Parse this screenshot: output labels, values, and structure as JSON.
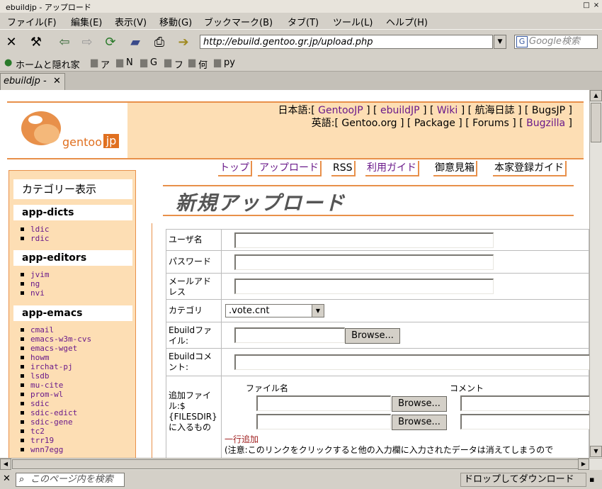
{
  "window": {
    "title": "ebuildjp - アップロード"
  },
  "menu": [
    "ファイル(F)",
    "編集(E)",
    "表示(V)",
    "移動(G)",
    "ブックマーク(B)",
    "タブ(T)",
    "ツール(L)",
    "ヘルプ(H)"
  ],
  "toolbar": {
    "url": "http://ebuild.gentoo.gr.jp/upload.php",
    "search_placeholder": "Google検索"
  },
  "bookmarks": [
    "ホームと隠れ家",
    "ア",
    "N",
    "G",
    "フ",
    "何",
    "py"
  ],
  "tab": {
    "label": "ebuildjp -"
  },
  "header": {
    "logo_text": "gentoo",
    "logo_badge": "jp",
    "jp_label": "日本語:",
    "jp_links": [
      "GentooJP",
      "ebuildJP",
      "Wiki",
      "航海日誌",
      "BugsJP"
    ],
    "en_label": "英語:",
    "en_links": [
      "Gentoo.org",
      "Package",
      "Forums",
      "Bugzilla"
    ]
  },
  "nav": [
    "トップ",
    "アップロード",
    "RSS",
    "利用ガイド",
    "御意見箱",
    "本家登録ガイド"
  ],
  "sidebar": {
    "title": "カテゴリー表示",
    "groups": [
      {
        "name": "app-dicts",
        "items": [
          "ldic",
          "rdic"
        ]
      },
      {
        "name": "app-editors",
        "items": [
          "jvim",
          "ng",
          "nvi"
        ]
      },
      {
        "name": "app-emacs",
        "items": [
          "cmail",
          "emacs-w3m-cvs",
          "emacs-wget",
          "howm",
          "irchat-pj",
          "lsdb",
          "mu-cite",
          "prom-wl",
          "sdic",
          "sdic-edict",
          "sdic-gene",
          "tc2",
          "trr19",
          "wnn7egg"
        ]
      }
    ]
  },
  "page_title": "新規アップロード",
  "form": {
    "user_label": "ユーザ名",
    "password_label": "パスワード",
    "email_label": "メールアドレス",
    "category_label": "カテゴリ",
    "category_value": ".vote.cnt",
    "ebuild_file_label": "Ebuildファイル:",
    "ebuild_comment_label": "Ebuildコメント:",
    "browse": "Browse...",
    "extra_label": "追加ファイル:$ {FILESDIR}に入るもの",
    "col_filename": "ファイル名",
    "col_comment": "コメント",
    "add_row": "一行追加",
    "note": "(注意:このリンクをクリックすると他の入力欄に入力されたデータは消えてしまうので"
  },
  "status": {
    "find_placeholder": "このページ内を検索",
    "text": "ドロップしてダウンロード"
  }
}
